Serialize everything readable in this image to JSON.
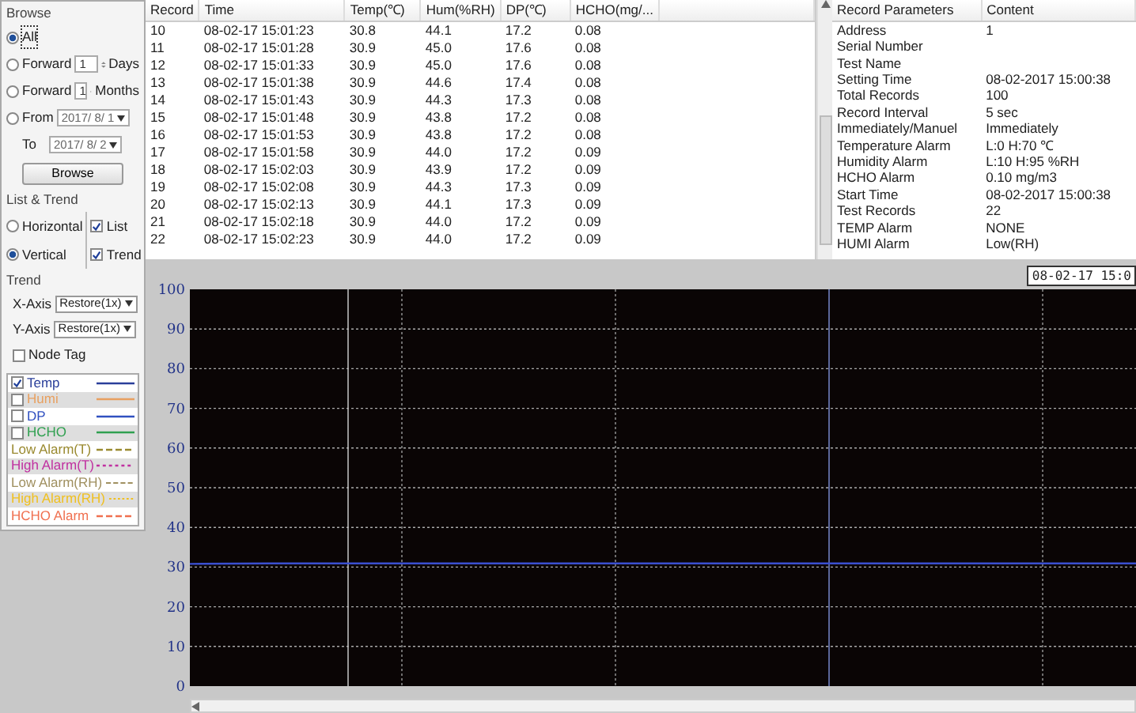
{
  "browse": {
    "title": "Browse",
    "options": [
      {
        "kind": "all",
        "label": "All",
        "selected": true
      },
      {
        "kind": "spin",
        "label": "Forward",
        "value": "1",
        "unit": "Days",
        "selected": false
      },
      {
        "kind": "spin",
        "label": "Forward",
        "value": "1",
        "unit": "Months",
        "selected": false
      },
      {
        "kind": "range",
        "label": "From",
        "value": "2017/ 8/ 1",
        "to_label": "To",
        "to_value": "2017/ 8/ 2",
        "selected": false
      }
    ],
    "button": "Browse"
  },
  "list_trend": {
    "title": "List & Trend",
    "layouts": [
      {
        "label": "Horizontal",
        "selected": false
      },
      {
        "label": "Vertical",
        "selected": true
      }
    ],
    "views": [
      {
        "label": "List",
        "checked": true
      },
      {
        "label": "Trend",
        "checked": true
      }
    ]
  },
  "trend": {
    "title": "Trend",
    "axes": [
      {
        "label": "X-Axis",
        "value": "Restore(1x)"
      },
      {
        "label": "Y-Axis",
        "value": "Restore(1x)"
      }
    ],
    "node_tag": {
      "label": "Node Tag",
      "checked": false
    }
  },
  "legend": [
    {
      "kind": "series",
      "label": "Temp",
      "checked": true,
      "color": "#2a3f9a"
    },
    {
      "kind": "series",
      "label": "Humi",
      "checked": false,
      "color": "#e8a060"
    },
    {
      "kind": "series",
      "label": "DP",
      "checked": false,
      "color": "#3050c0"
    },
    {
      "kind": "series",
      "label": "HCHO",
      "checked": false,
      "color": "#30a050"
    },
    {
      "kind": "alarm",
      "label": "Low Alarm(T)",
      "color": "#9a8a30"
    },
    {
      "kind": "alarm",
      "label": "High Alarm(T)",
      "color": "#c030a0"
    },
    {
      "kind": "alarm",
      "label": "Low Alarm(RH)",
      "color": "#a09060"
    },
    {
      "kind": "alarm",
      "label": "High Alarm(RH)",
      "color": "#f0c020"
    },
    {
      "kind": "alarm",
      "label": "HCHO Alarm",
      "color": "#f07050"
    }
  ],
  "records": {
    "columns": [
      "Record",
      "Time",
      "Temp(℃)",
      "Hum(%RH)",
      "DP(℃)",
      "HCHO(mg/..."
    ],
    "rows": [
      [
        "10",
        "08-02-17 15:01:23",
        "30.8",
        "44.1",
        "17.2",
        "0.08"
      ],
      [
        "11",
        "08-02-17 15:01:28",
        "30.9",
        "45.0",
        "17.6",
        "0.08"
      ],
      [
        "12",
        "08-02-17 15:01:33",
        "30.9",
        "45.0",
        "17.6",
        "0.08"
      ],
      [
        "13",
        "08-02-17 15:01:38",
        "30.9",
        "44.6",
        "17.4",
        "0.08"
      ],
      [
        "14",
        "08-02-17 15:01:43",
        "30.9",
        "44.3",
        "17.3",
        "0.08"
      ],
      [
        "15",
        "08-02-17 15:01:48",
        "30.9",
        "43.8",
        "17.2",
        "0.08"
      ],
      [
        "16",
        "08-02-17 15:01:53",
        "30.9",
        "43.8",
        "17.2",
        "0.08"
      ],
      [
        "17",
        "08-02-17 15:01:58",
        "30.9",
        "44.0",
        "17.2",
        "0.09"
      ],
      [
        "18",
        "08-02-17 15:02:03",
        "30.9",
        "43.9",
        "17.2",
        "0.09"
      ],
      [
        "19",
        "08-02-17 15:02:08",
        "30.9",
        "44.3",
        "17.3",
        "0.09"
      ],
      [
        "20",
        "08-02-17 15:02:13",
        "30.9",
        "44.1",
        "17.3",
        "0.09"
      ],
      [
        "21",
        "08-02-17 15:02:18",
        "30.9",
        "44.0",
        "17.2",
        "0.09"
      ],
      [
        "22",
        "08-02-17 15:02:23",
        "30.9",
        "44.0",
        "17.2",
        "0.09"
      ]
    ]
  },
  "parameters": {
    "columns": [
      "Record Parameters",
      "Content"
    ],
    "rows": [
      [
        "Address",
        "1"
      ],
      [
        "Serial Number",
        ""
      ],
      [
        "Test Name",
        ""
      ],
      [
        "Setting Time",
        "08-02-2017 15:00:38"
      ],
      [
        "Total Records",
        "100"
      ],
      [
        "Record Interval",
        "5 sec"
      ],
      [
        "Immediately/Manuel",
        "Immediately"
      ],
      [
        "Temperature Alarm",
        "L:0 H:70 ℃"
      ],
      [
        "Humidity Alarm",
        "L:10 H:95 %RH"
      ],
      [
        "HCHO Alarm",
        "0.10 mg/m3"
      ],
      [
        "Start Time",
        "08-02-2017 15:00:38"
      ],
      [
        "Test Records",
        "22"
      ],
      [
        "TEMP Alarm",
        "NONE"
      ],
      [
        "HUMI Alarm",
        "Low(RH)"
      ]
    ]
  },
  "chart": {
    "cursor_time": "08-02-17 15:0",
    "chart_data": {
      "type": "line",
      "grid": true,
      "ylim": [
        0,
        100
      ],
      "yticks": [
        0,
        10,
        20,
        30,
        40,
        50,
        60,
        70,
        80,
        90,
        100
      ],
      "series": [
        {
          "color": "#3a4fd0",
          "values": [
            30.8,
            30.9,
            30.9,
            30.9,
            30.9,
            30.9,
            30.9,
            30.9,
            30.9,
            30.9,
            30.9,
            30.9,
            30.9
          ]
        }
      ]
    }
  }
}
